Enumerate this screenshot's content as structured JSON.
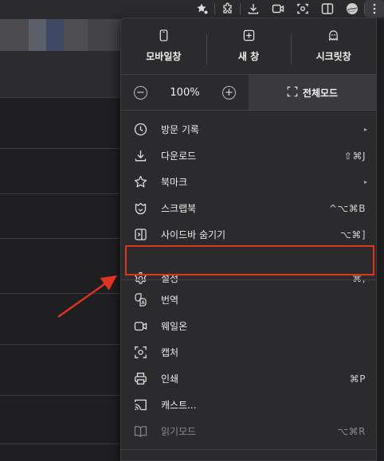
{
  "top_buttons": [
    {
      "label": "모바일창",
      "icon": "mobile-icon"
    },
    {
      "label": "새 창",
      "icon": "new-window-icon"
    },
    {
      "label": "시크릿창",
      "icon": "ghost-icon"
    }
  ],
  "zoom": {
    "minus": "−",
    "value": "100%",
    "plus": "+",
    "fullscreen_label": "전체모드"
  },
  "menu_items": [
    {
      "label": "방문 기록",
      "shortcut": "",
      "submenu": "▸",
      "icon": "clock-icon"
    },
    {
      "label": "다운로드",
      "shortcut": "⇧⌘J",
      "submenu": "",
      "icon": "download-icon"
    },
    {
      "label": "북마크",
      "shortcut": "",
      "submenu": "▸",
      "icon": "star-icon"
    },
    {
      "label": "스크랩북",
      "shortcut": "^⌥⌘B",
      "submenu": "",
      "icon": "scrapbook-icon"
    },
    {
      "label": "사이드바 숨기기",
      "shortcut": "⌥⌘]",
      "submenu": "",
      "icon": "sidebar-icon"
    },
    {
      "label": "설정",
      "shortcut": "⌘,",
      "submenu": "",
      "icon": "gear-icon"
    },
    {
      "label": "번역",
      "shortcut": "",
      "submenu": "",
      "icon": "translate-icon"
    },
    {
      "label": "웨일온",
      "shortcut": "",
      "submenu": "",
      "icon": "video-icon"
    },
    {
      "label": "캡처",
      "shortcut": "",
      "submenu": "",
      "icon": "capture-icon"
    },
    {
      "label": "인쇄",
      "shortcut": "⌘P",
      "submenu": "",
      "icon": "printer-icon"
    },
    {
      "label": "캐스트...",
      "shortcut": "",
      "submenu": "",
      "icon": "cast-icon"
    },
    {
      "label": "읽기모드",
      "shortcut": "⌥⌘R",
      "submenu": "",
      "icon": "book-icon"
    }
  ],
  "colors": {
    "highlight": "#e0341f",
    "menu_bg": "#2b2b2e",
    "page_bg": "#1f1f21"
  }
}
